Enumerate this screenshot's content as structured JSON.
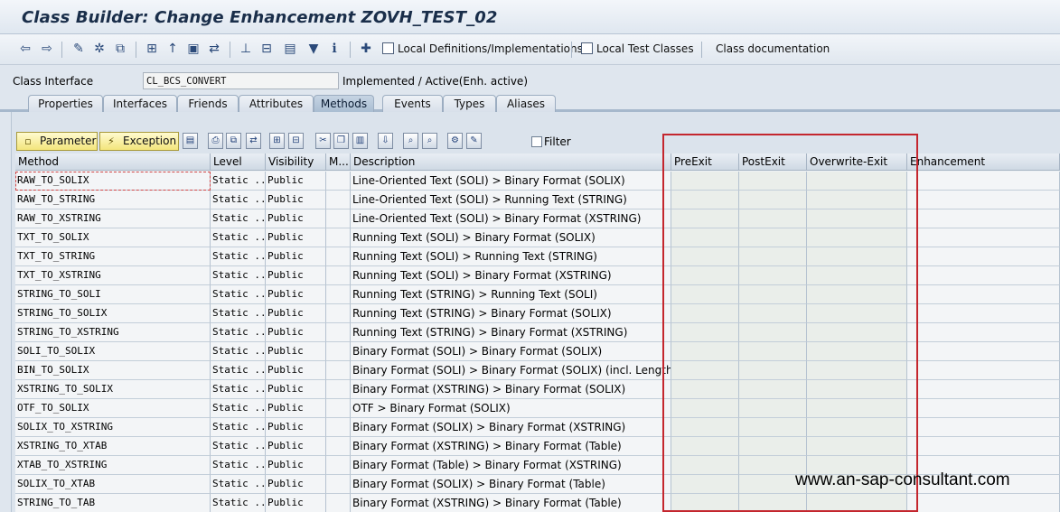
{
  "window": {
    "title": "Class Builder: Change Enhancement ZOVH_TEST_02"
  },
  "toolbar": {
    "local_definitions": "Local Definitions/Implementations",
    "local_test_classes": "Local Test Classes",
    "class_documentation": "Class documentation"
  },
  "header": {
    "class_interface_label": "Class Interface",
    "class_interface_value": "CL_BCS_CONVERT",
    "status": "Implemented / Active(Enh. active)"
  },
  "tabs": [
    {
      "label": "Properties"
    },
    {
      "label": "Interfaces"
    },
    {
      "label": "Friends"
    },
    {
      "label": "Attributes"
    },
    {
      "label": "Methods"
    },
    {
      "label": "Events"
    },
    {
      "label": "Types"
    },
    {
      "label": "Aliases"
    }
  ],
  "method_toolbar": {
    "parameter": "Parameter",
    "exception": "Exception",
    "filter": "Filter"
  },
  "grid": {
    "columns": [
      "Method",
      "Level",
      "Visibility",
      "M...",
      "Description",
      "PreExit",
      "PostExit",
      "Overwrite-Exit",
      "Enhancement"
    ],
    "rows": [
      {
        "method": "RAW_TO_SOLIX",
        "level": "Static ...",
        "visibility": "Public",
        "description": "Line-Oriented Text (SOLI) > Binary Format (SOLIX)"
      },
      {
        "method": "RAW_TO_STRING",
        "level": "Static ...",
        "visibility": "Public",
        "description": "Line-Oriented Text (SOLI) > Running Text (STRING)"
      },
      {
        "method": "RAW_TO_XSTRING",
        "level": "Static ...",
        "visibility": "Public",
        "description": "Line-Oriented Text (SOLI) > Binary Format (XSTRING)"
      },
      {
        "method": "TXT_TO_SOLIX",
        "level": "Static ...",
        "visibility": "Public",
        "description": "Running Text (SOLI) > Binary Format (SOLIX)"
      },
      {
        "method": "TXT_TO_STRING",
        "level": "Static ...",
        "visibility": "Public",
        "description": "Running Text (SOLI) >  Running Text (STRING)"
      },
      {
        "method": "TXT_TO_XSTRING",
        "level": "Static ...",
        "visibility": "Public",
        "description": "Running Text (SOLI) >  Binary Format (XSTRING)"
      },
      {
        "method": "STRING_TO_SOLI",
        "level": "Static ...",
        "visibility": "Public",
        "description": "Running Text (STRING) > Running Text (SOLI)"
      },
      {
        "method": "STRING_TO_SOLIX",
        "level": "Static ...",
        "visibility": "Public",
        "description": "Running Text (STRING) > Binary Format (SOLIX)"
      },
      {
        "method": "STRING_TO_XSTRING",
        "level": "Static ...",
        "visibility": "Public",
        "description": "Running Text (STRING) > Binary Format (XSTRING)"
      },
      {
        "method": "SOLI_TO_SOLIX",
        "level": "Static ...",
        "visibility": "Public",
        "description": "Binary Format (SOLI) > Binary Format (SOLIX)"
      },
      {
        "method": "BIN_TO_SOLIX",
        "level": "Static ...",
        "visibility": "Public",
        "description": "Binary Format (SOLI) > Binary Format (SOLIX) (incl. Length)"
      },
      {
        "method": "XSTRING_TO_SOLIX",
        "level": "Static ...",
        "visibility": "Public",
        "description": "Binary Format (XSTRING) > Binary Format (SOLIX)"
      },
      {
        "method": "OTF_TO_SOLIX",
        "level": "Static ...",
        "visibility": "Public",
        "description": "OTF > Binary Format (SOLIX)"
      },
      {
        "method": "SOLIX_TO_XSTRING",
        "level": "Static ...",
        "visibility": "Public",
        "description": "Binary Format (SOLIX) > Binary Format (XSTRING)"
      },
      {
        "method": "XSTRING_TO_XTAB",
        "level": "Static ...",
        "visibility": "Public",
        "description": "Binary Format (XSTRING) > Binary Format (Table)"
      },
      {
        "method": "XTAB_TO_XSTRING",
        "level": "Static ...",
        "visibility": "Public",
        "description": "Binary Format (Table) > Binary Format (XSTRING)"
      },
      {
        "method": "SOLIX_TO_XTAB",
        "level": "Static ...",
        "visibility": "Public",
        "description": "Binary Format (SOLIX) > Binary Format (Table)"
      },
      {
        "method": "STRING_TO_TAB",
        "level": "Static ...",
        "visibility": "Public",
        "description": "Binary Format (XSTRING) > Binary Format (Table)"
      }
    ]
  },
  "watermark": "www.an-sap-consultant.com",
  "colors": {
    "highlight_box": "#c4262e",
    "active_tab": "#a9bdd2",
    "button_yellow": "#f3e57c"
  }
}
